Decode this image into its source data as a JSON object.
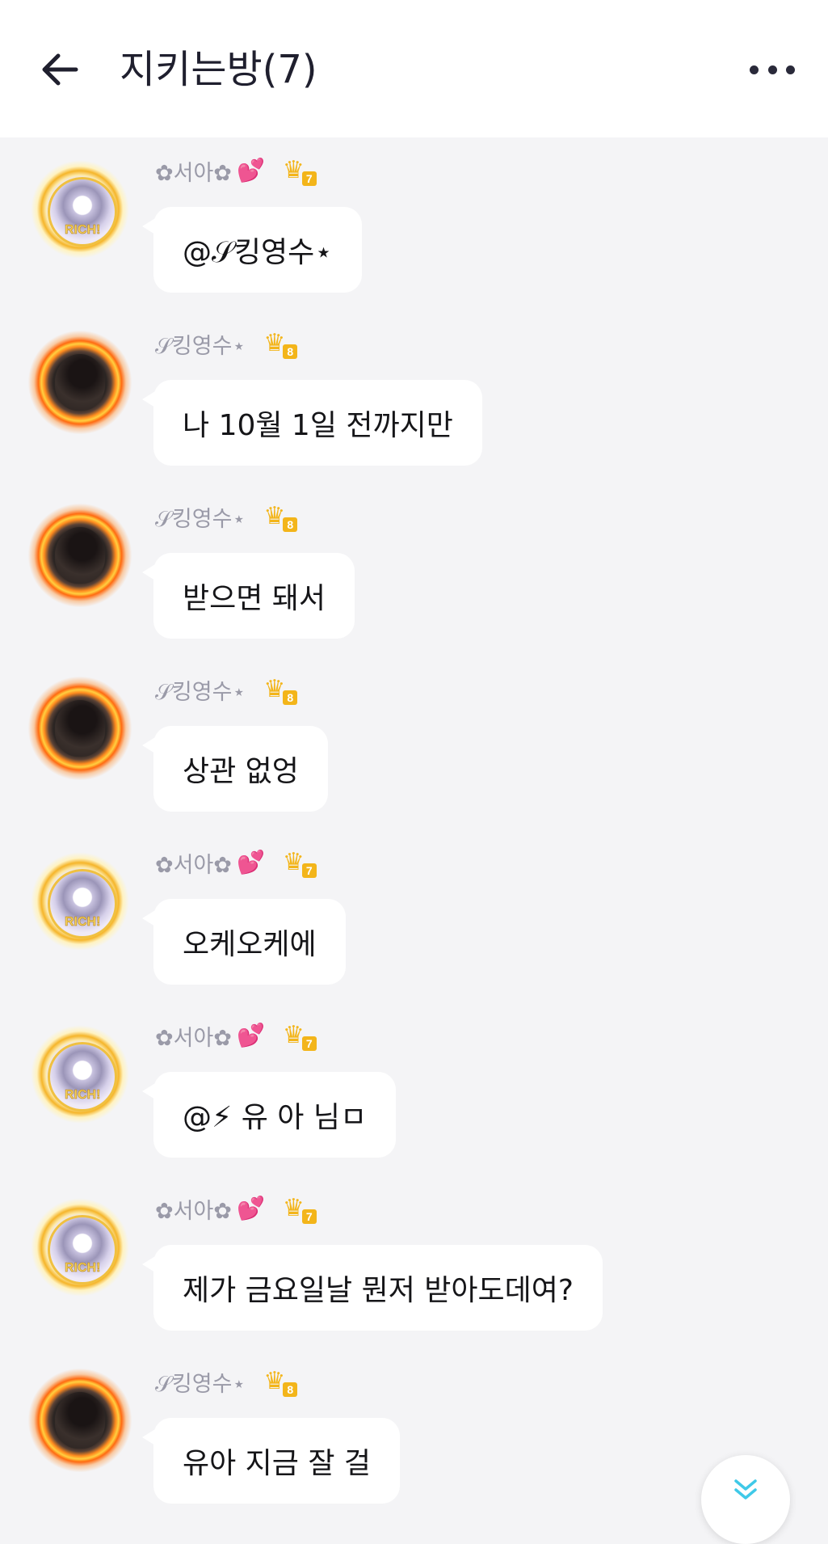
{
  "header": {
    "title": "지키는방(7)",
    "back_icon": "arrow-left-icon",
    "more_icon": "more-horizontal-icon"
  },
  "colors": {
    "background": "#f4f4f6",
    "bubble": "#ffffff",
    "name": "#9a9aa8",
    "heart": "#ff3d9a",
    "crown": "#f3b51a",
    "scroll_chevron": "#3fc9e8"
  },
  "messages": [
    {
      "sender": "✿서아✿",
      "heart": "💕",
      "level": "7",
      "avatar": "seoa",
      "text": "@𝒮킹영수⋆"
    },
    {
      "sender": "𝒮킹영수⋆",
      "heart": "",
      "level": "8",
      "avatar": "king",
      "text": "나 10월 1일 전까지만"
    },
    {
      "sender": "𝒮킹영수⋆",
      "heart": "",
      "level": "8",
      "avatar": "king",
      "text": "받으면 돼서"
    },
    {
      "sender": "𝒮킹영수⋆",
      "heart": "",
      "level": "8",
      "avatar": "king",
      "text": "상관 없엉"
    },
    {
      "sender": "✿서아✿",
      "heart": "💕",
      "level": "7",
      "avatar": "seoa",
      "text": "오케오케에"
    },
    {
      "sender": "✿서아✿",
      "heart": "💕",
      "level": "7",
      "avatar": "seoa",
      "text": "@⚡ 유 아 님ㅁ"
    },
    {
      "sender": "✿서아✿",
      "heart": "💕",
      "level": "7",
      "avatar": "seoa",
      "text": "제가 금요일날 뭔저 받아도데여?"
    },
    {
      "sender": "𝒮킹영수⋆",
      "heart": "",
      "level": "8",
      "avatar": "king",
      "text": "유아 지금 잘 걸"
    }
  ],
  "scroll_down": {
    "icon": "double-chevron-down-icon"
  }
}
